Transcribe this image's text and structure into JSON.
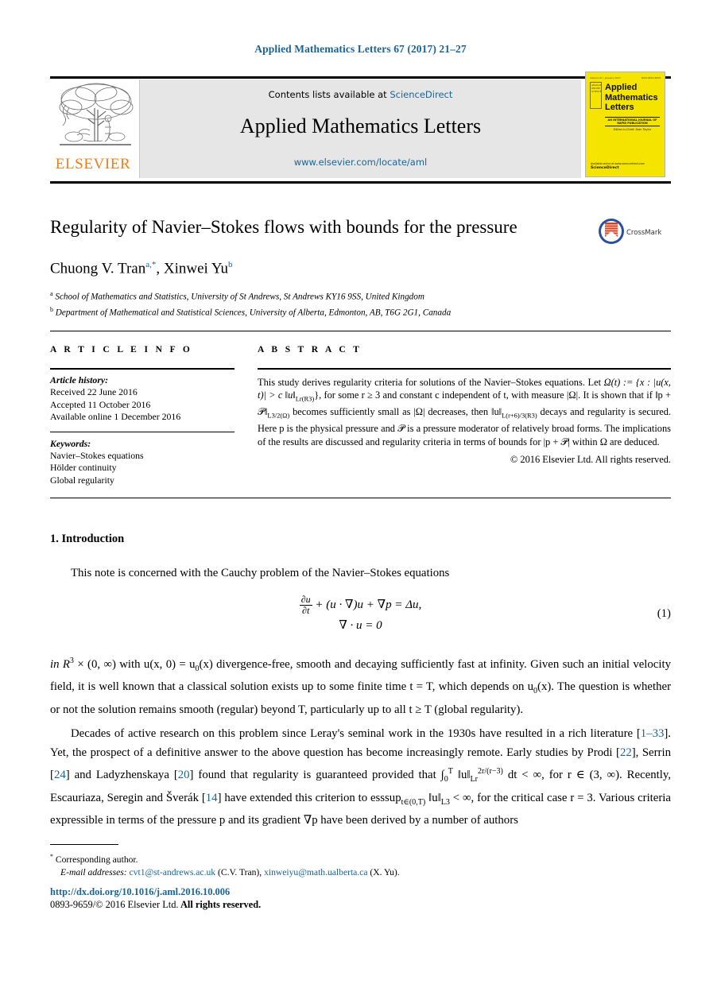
{
  "running_head": "Applied Mathematics Letters 67 (2017) 21–27",
  "masthead": {
    "contents_prefix": "Contents lists available at ",
    "sciencedirect": "ScienceDirect",
    "journal_name": "Applied Mathematics Letters",
    "journal_url": "www.elsevier.com/locate/aml",
    "publisher_wordmark": "ELSEVIER",
    "publisher_color": "#ef7d1a",
    "band_color": "#e6e6e6"
  },
  "cover": {
    "top_left": "Volume 67 / January 2017",
    "top_right": "ISSN 0893-9659",
    "badge": "AVAILABLE ONLINE SCIENCEDIRECT",
    "title_line1": "Applied",
    "title_line2": "Mathematics",
    "title_line3": "Letters",
    "subtitle": "AN INTERNATIONAL JOURNAL OF RAPID PUBLICATION",
    "editor": "Editor-in-Chief: Alan Taylor",
    "foot_line1": "Available online at www.sciencedirect.com",
    "foot_line2": "ScienceDirect",
    "background": "#f5e400"
  },
  "article": {
    "title": "Regularity of Navier–Stokes flows with bounds for the pressure",
    "crossmark_label": "CrossMark",
    "authors": [
      {
        "name": "Chuong V. Tran",
        "marks": "a,*"
      },
      {
        "name": "Xinwei Yu",
        "marks": "b"
      }
    ],
    "authors_separator": ", ",
    "affiliations": [
      {
        "mark": "a",
        "text": "School of Mathematics and Statistics, University of St Andrews, St Andrews KY16 9SS, United Kingdom"
      },
      {
        "mark": "b",
        "text": "Department of Mathematical and Statistical Sciences, University of Alberta, Edmonton, AB, T6G 2G1, Canada"
      }
    ]
  },
  "info": {
    "heading": "A R T I C L E   I N F O",
    "history_label": "Article history:",
    "history": [
      "Received 22 June 2016",
      "Accepted 11 October 2016",
      "Available online 1 December 2016"
    ],
    "keywords_label": "Keywords:",
    "keywords": [
      "Navier–Stokes equations",
      "Hölder continuity",
      "Global regularity"
    ]
  },
  "abstract": {
    "heading": "A B S T R A C T",
    "text_part_1": "This study derives regularity criteria for solutions of the Navier–Stokes equations. Let ",
    "omega_def": "Ω(t) := {x : |u(x, t)| > c ‖u‖",
    "lr_sub": "L",
    "lr_sup": "r",
    "lr_space": "(R",
    "lr_space_sup": "3",
    "lr_close": ")",
    "text_part_2": "}, for some r ≥ 3 and constant c independent of t, with measure |Ω|. It is shown that if ‖p + 𝒫‖",
    "norm_sub_1": "L",
    "norm_sub_1b": "3/2",
    "norm_sub_1c": "(Ω)",
    "text_part_3": " becomes sufficiently small as |Ω| decreases, then ‖u‖",
    "norm_sub_2": "L",
    "norm_sub_2b": "(r+6)/3",
    "norm_sub_2c": "(R",
    "norm_sub_2d": "3",
    "norm_sub_2e": ")",
    "text_part_4": " decays and regularity is secured. Here p is the physical pressure and 𝒫 is a pressure moderator of relatively broad forms. The implications of the results are discussed and regularity criteria in terms of bounds for |p + 𝒫| within Ω are deduced.",
    "copyright": "© 2016 Elsevier Ltd. All rights reserved."
  },
  "body": {
    "section_number": "1.",
    "section_title": "Introduction",
    "paragraph_1": "This note is concerned with the Cauchy problem of the Navier–Stokes equations",
    "equation": {
      "line1_frac_num": "∂u",
      "line1_frac_den": "∂t",
      "line1_rest": "+ (u · ∇)u + ∇p = Δu,",
      "line2": "∇ · u = 0",
      "number": "(1)"
    },
    "paragraph_2_a": "in R",
    "paragraph_2_sup": "3",
    "paragraph_2_b": " × (0, ∞) with u(x, 0) = u",
    "paragraph_2_sub": "0",
    "paragraph_2_c": "(x) divergence-free, smooth and decaying sufficiently fast at infinity. Given such an initial velocity field, it is well known that a classical solution exists up to some finite time t = T, which depends on u",
    "paragraph_2_d": "(x). The question is whether or not the solution remains smooth (regular) beyond T, particularly up to all t ≥ T (global regularity).",
    "paragraph_3_a": "Decades of active research on this problem since Leray's seminal work in the 1930s have resulted in a rich literature [",
    "ref_1_33": "1–33",
    "paragraph_3_b": "]. Yet, the prospect of a definitive answer to the above question has become increasingly remote. Early studies by Prodi [",
    "ref_22": "22",
    "paragraph_3_c": "], Serrin [",
    "ref_24": "24",
    "paragraph_3_d": "] and Ladyzhenskaya [",
    "ref_20": "20",
    "paragraph_3_e": "] found that regularity is guaranteed provided that ∫",
    "int_lower": "0",
    "int_upper": "T",
    "paragraph_3_f": " ‖u‖",
    "norm_sub": "L",
    "norm_sub_r": "r",
    "norm_sup": "2r/(r−3)",
    "paragraph_3_g": " dt < ∞, for r ∈ (3, ∞). Recently, Escauriaza, Seregin and Šverák [",
    "ref_14": "14",
    "paragraph_3_h": "] have extended this criterion to esssup",
    "esssup_sub": "t∈(0,T)",
    "paragraph_3_i": " ‖u‖",
    "l3_sub": "L",
    "l3_sup": "3",
    "paragraph_3_j": " < ∞, for the critical case r = 3. Various criteria expressible in terms of the pressure p and its gradient ∇p have been derived by a number of authors"
  },
  "footer": {
    "corresponding_marker": "*",
    "corresponding_text": "Corresponding author.",
    "email_label": "E-mail addresses:",
    "emails": [
      {
        "address": "cvt1@st-andrews.ac.uk",
        "owner": "(C.V. Tran)"
      },
      {
        "address": "xinweiyu@math.ualberta.ca",
        "owner": "(X. Yu)."
      }
    ],
    "email_separator": ", ",
    "doi": "http://dx.doi.org/10.1016/j.aml.2016.10.006",
    "issn_prefix": "0893-9659/",
    "issn_copyright": "© 2016 Elsevier Ltd.",
    "issn_rights": " All rights reserved."
  },
  "colors": {
    "link": "#1a6496",
    "accent_orange": "#ef7d1a"
  }
}
